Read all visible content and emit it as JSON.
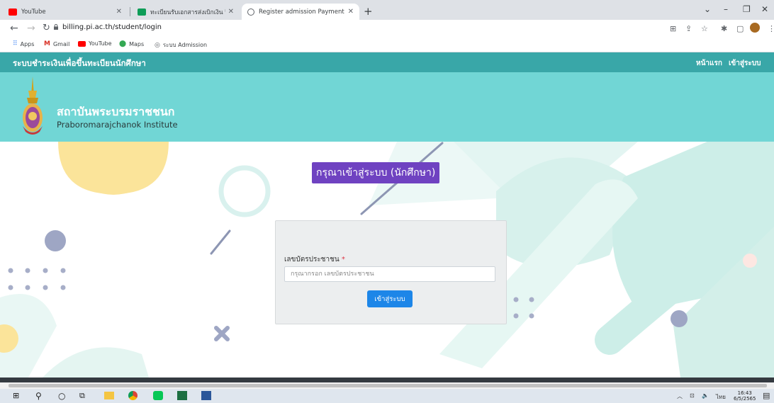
{
  "browser": {
    "tabs": [
      {
        "title": "YouTube",
        "favicon_color": "#ff0000"
      },
      {
        "title": "ทะเบียนรับเอกสารส่งเบิกเงิน ปีงบประมาณ",
        "favicon_color": "#0f9d58"
      },
      {
        "title": "Register admission Payment",
        "favicon_color": "#5f6368"
      }
    ],
    "new_tab_label": "+",
    "url": "billing.pi.ac.th/student/login",
    "bookmarks": [
      {
        "label": "Apps",
        "icon": "apps-grid-icon"
      },
      {
        "label": "Gmail",
        "icon": "gmail-icon"
      },
      {
        "label": "YouTube",
        "icon": "youtube-icon"
      },
      {
        "label": "Maps",
        "icon": "maps-pin-icon"
      },
      {
        "label": "ระบบ Admission",
        "icon": "globe-icon"
      }
    ]
  },
  "site": {
    "title": "ระบบชำระเงินเพื่อขึ้นทะเบียนนักศึกษา",
    "nav": {
      "home": "หน้าแรก",
      "login": "เข้าสู่ระบบ"
    },
    "institute_th": "สถาบันพระบรมราชชนก",
    "institute_en": "Praboromarajchanok Institute",
    "accent": "#39a7a8"
  },
  "login": {
    "heading": "กรุณาเข้าสู่ระบบ (นักศึกษา)",
    "id_label": "เลขบัตรประชาชน",
    "required_mark": "*",
    "id_placeholder": "กรุณากรอก เลขบัตรประชาชน",
    "id_value": "",
    "submit_label": "เข้าสู่ระบบ"
  },
  "taskbar": {
    "time": "16:43",
    "date": "6/5/2565",
    "lang": "ไทย"
  }
}
